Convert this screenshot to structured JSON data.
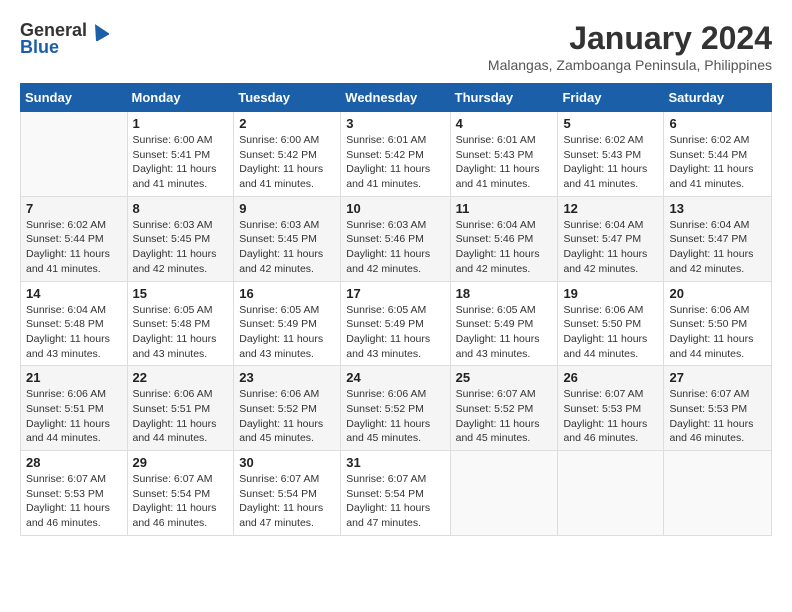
{
  "logo": {
    "general": "General",
    "blue": "Blue"
  },
  "title": "January 2024",
  "subtitle": "Malangas, Zamboanga Peninsula, Philippines",
  "days_of_week": [
    "Sunday",
    "Monday",
    "Tuesday",
    "Wednesday",
    "Thursday",
    "Friday",
    "Saturday"
  ],
  "weeks": [
    [
      {
        "day": "",
        "sunrise": "",
        "sunset": "",
        "daylight": ""
      },
      {
        "day": "1",
        "sunrise": "Sunrise: 6:00 AM",
        "sunset": "Sunset: 5:41 PM",
        "daylight": "Daylight: 11 hours and 41 minutes."
      },
      {
        "day": "2",
        "sunrise": "Sunrise: 6:00 AM",
        "sunset": "Sunset: 5:42 PM",
        "daylight": "Daylight: 11 hours and 41 minutes."
      },
      {
        "day": "3",
        "sunrise": "Sunrise: 6:01 AM",
        "sunset": "Sunset: 5:42 PM",
        "daylight": "Daylight: 11 hours and 41 minutes."
      },
      {
        "day": "4",
        "sunrise": "Sunrise: 6:01 AM",
        "sunset": "Sunset: 5:43 PM",
        "daylight": "Daylight: 11 hours and 41 minutes."
      },
      {
        "day": "5",
        "sunrise": "Sunrise: 6:02 AM",
        "sunset": "Sunset: 5:43 PM",
        "daylight": "Daylight: 11 hours and 41 minutes."
      },
      {
        "day": "6",
        "sunrise": "Sunrise: 6:02 AM",
        "sunset": "Sunset: 5:44 PM",
        "daylight": "Daylight: 11 hours and 41 minutes."
      }
    ],
    [
      {
        "day": "7",
        "sunrise": "Sunrise: 6:02 AM",
        "sunset": "Sunset: 5:44 PM",
        "daylight": "Daylight: 11 hours and 41 minutes."
      },
      {
        "day": "8",
        "sunrise": "Sunrise: 6:03 AM",
        "sunset": "Sunset: 5:45 PM",
        "daylight": "Daylight: 11 hours and 42 minutes."
      },
      {
        "day": "9",
        "sunrise": "Sunrise: 6:03 AM",
        "sunset": "Sunset: 5:45 PM",
        "daylight": "Daylight: 11 hours and 42 minutes."
      },
      {
        "day": "10",
        "sunrise": "Sunrise: 6:03 AM",
        "sunset": "Sunset: 5:46 PM",
        "daylight": "Daylight: 11 hours and 42 minutes."
      },
      {
        "day": "11",
        "sunrise": "Sunrise: 6:04 AM",
        "sunset": "Sunset: 5:46 PM",
        "daylight": "Daylight: 11 hours and 42 minutes."
      },
      {
        "day": "12",
        "sunrise": "Sunrise: 6:04 AM",
        "sunset": "Sunset: 5:47 PM",
        "daylight": "Daylight: 11 hours and 42 minutes."
      },
      {
        "day": "13",
        "sunrise": "Sunrise: 6:04 AM",
        "sunset": "Sunset: 5:47 PM",
        "daylight": "Daylight: 11 hours and 42 minutes."
      }
    ],
    [
      {
        "day": "14",
        "sunrise": "Sunrise: 6:04 AM",
        "sunset": "Sunset: 5:48 PM",
        "daylight": "Daylight: 11 hours and 43 minutes."
      },
      {
        "day": "15",
        "sunrise": "Sunrise: 6:05 AM",
        "sunset": "Sunset: 5:48 PM",
        "daylight": "Daylight: 11 hours and 43 minutes."
      },
      {
        "day": "16",
        "sunrise": "Sunrise: 6:05 AM",
        "sunset": "Sunset: 5:49 PM",
        "daylight": "Daylight: 11 hours and 43 minutes."
      },
      {
        "day": "17",
        "sunrise": "Sunrise: 6:05 AM",
        "sunset": "Sunset: 5:49 PM",
        "daylight": "Daylight: 11 hours and 43 minutes."
      },
      {
        "day": "18",
        "sunrise": "Sunrise: 6:05 AM",
        "sunset": "Sunset: 5:49 PM",
        "daylight": "Daylight: 11 hours and 43 minutes."
      },
      {
        "day": "19",
        "sunrise": "Sunrise: 6:06 AM",
        "sunset": "Sunset: 5:50 PM",
        "daylight": "Daylight: 11 hours and 44 minutes."
      },
      {
        "day": "20",
        "sunrise": "Sunrise: 6:06 AM",
        "sunset": "Sunset: 5:50 PM",
        "daylight": "Daylight: 11 hours and 44 minutes."
      }
    ],
    [
      {
        "day": "21",
        "sunrise": "Sunrise: 6:06 AM",
        "sunset": "Sunset: 5:51 PM",
        "daylight": "Daylight: 11 hours and 44 minutes."
      },
      {
        "day": "22",
        "sunrise": "Sunrise: 6:06 AM",
        "sunset": "Sunset: 5:51 PM",
        "daylight": "Daylight: 11 hours and 44 minutes."
      },
      {
        "day": "23",
        "sunrise": "Sunrise: 6:06 AM",
        "sunset": "Sunset: 5:52 PM",
        "daylight": "Daylight: 11 hours and 45 minutes."
      },
      {
        "day": "24",
        "sunrise": "Sunrise: 6:06 AM",
        "sunset": "Sunset: 5:52 PM",
        "daylight": "Daylight: 11 hours and 45 minutes."
      },
      {
        "day": "25",
        "sunrise": "Sunrise: 6:07 AM",
        "sunset": "Sunset: 5:52 PM",
        "daylight": "Daylight: 11 hours and 45 minutes."
      },
      {
        "day": "26",
        "sunrise": "Sunrise: 6:07 AM",
        "sunset": "Sunset: 5:53 PM",
        "daylight": "Daylight: 11 hours and 46 minutes."
      },
      {
        "day": "27",
        "sunrise": "Sunrise: 6:07 AM",
        "sunset": "Sunset: 5:53 PM",
        "daylight": "Daylight: 11 hours and 46 minutes."
      }
    ],
    [
      {
        "day": "28",
        "sunrise": "Sunrise: 6:07 AM",
        "sunset": "Sunset: 5:53 PM",
        "daylight": "Daylight: 11 hours and 46 minutes."
      },
      {
        "day": "29",
        "sunrise": "Sunrise: 6:07 AM",
        "sunset": "Sunset: 5:54 PM",
        "daylight": "Daylight: 11 hours and 46 minutes."
      },
      {
        "day": "30",
        "sunrise": "Sunrise: 6:07 AM",
        "sunset": "Sunset: 5:54 PM",
        "daylight": "Daylight: 11 hours and 47 minutes."
      },
      {
        "day": "31",
        "sunrise": "Sunrise: 6:07 AM",
        "sunset": "Sunset: 5:54 PM",
        "daylight": "Daylight: 11 hours and 47 minutes."
      },
      {
        "day": "",
        "sunrise": "",
        "sunset": "",
        "daylight": ""
      },
      {
        "day": "",
        "sunrise": "",
        "sunset": "",
        "daylight": ""
      },
      {
        "day": "",
        "sunrise": "",
        "sunset": "",
        "daylight": ""
      }
    ]
  ]
}
